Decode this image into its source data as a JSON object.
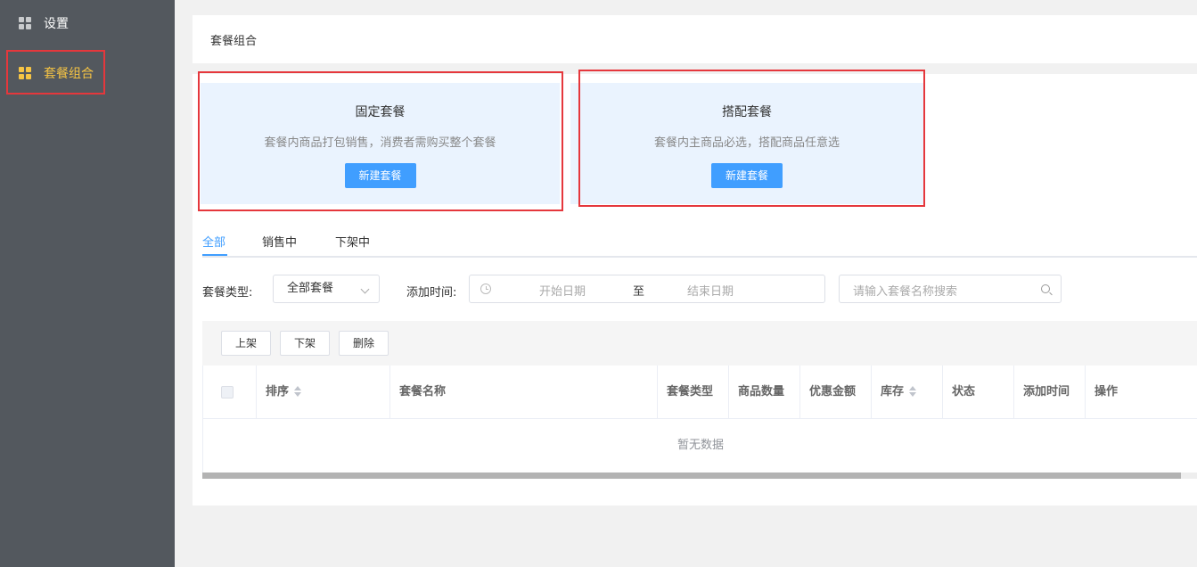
{
  "sidebar": {
    "items": [
      {
        "label": "设置",
        "icon": "grid-icon"
      },
      {
        "label": "套餐组合",
        "icon": "grid-icon",
        "active": true
      }
    ]
  },
  "header": {
    "title": "套餐组合"
  },
  "package_types": [
    {
      "title": "固定套餐",
      "desc": "套餐内商品打包销售，消费者需购买整个套餐",
      "button": "新建套餐"
    },
    {
      "title": "搭配套餐",
      "desc": "套餐内主商品必选，搭配商品任意选",
      "button": "新建套餐"
    }
  ],
  "tabs": [
    {
      "label": "全部",
      "active": true
    },
    {
      "label": "销售中"
    },
    {
      "label": "下架中"
    }
  ],
  "filters": {
    "type_label": "套餐类型:",
    "type_value": "全部套餐",
    "time_label": "添加时间:",
    "start_placeholder": "开始日期",
    "range_sep": "至",
    "end_placeholder": "结束日期",
    "search_placeholder": "请输入套餐名称搜索"
  },
  "toolbar": {
    "up": "上架",
    "down": "下架",
    "delete": "删除"
  },
  "table": {
    "columns": [
      "排序",
      "套餐名称",
      "套餐类型",
      "商品数量",
      "优惠金额",
      "库存",
      "状态",
      "添加时间",
      "操作"
    ],
    "empty_text": "暂无数据"
  },
  "colors": {
    "accent": "#409eff",
    "sidebar_bg": "#53585e",
    "active_menu": "#f6c444",
    "highlight_box": "#e5373c"
  }
}
